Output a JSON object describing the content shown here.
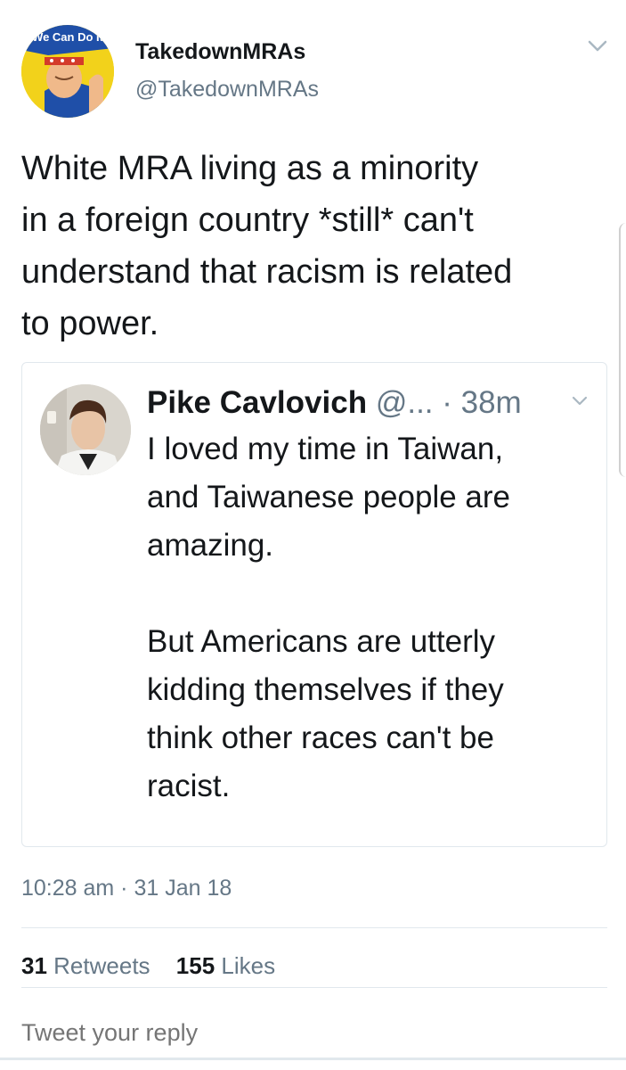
{
  "tweet": {
    "author_name": "TakedownMRAs",
    "author_handle": "@TakedownMRAs",
    "avatar_text": "We Can Do It",
    "text": "White MRA living as a minority\nin a foreign country *still* can't\nunderstand that racism is related\nto power.",
    "timestamp": "10:28 am · 31 Jan 18"
  },
  "quoted_tweet": {
    "author_name": "Pike Cavlovich",
    "author_handle": "@...",
    "separator": " · ",
    "time": "38m",
    "text": "I loved my time in Taiwan,\nand Taiwanese people are\namazing.\n\nBut Americans are utterly\nkidding themselves if they\nthink other races can't be\nracist."
  },
  "stats": {
    "retweets_count": "31",
    "retweets_label": "Retweets",
    "likes_count": "155",
    "likes_label": "Likes"
  },
  "reply": {
    "placeholder": "Tweet your reply"
  },
  "icons": {
    "header_menu": "chevron-down-icon",
    "quote_menu": "chevron-down-icon"
  },
  "colors": {
    "text_primary": "#14171a",
    "text_secondary": "#657786",
    "border": "#e1e8ed"
  }
}
